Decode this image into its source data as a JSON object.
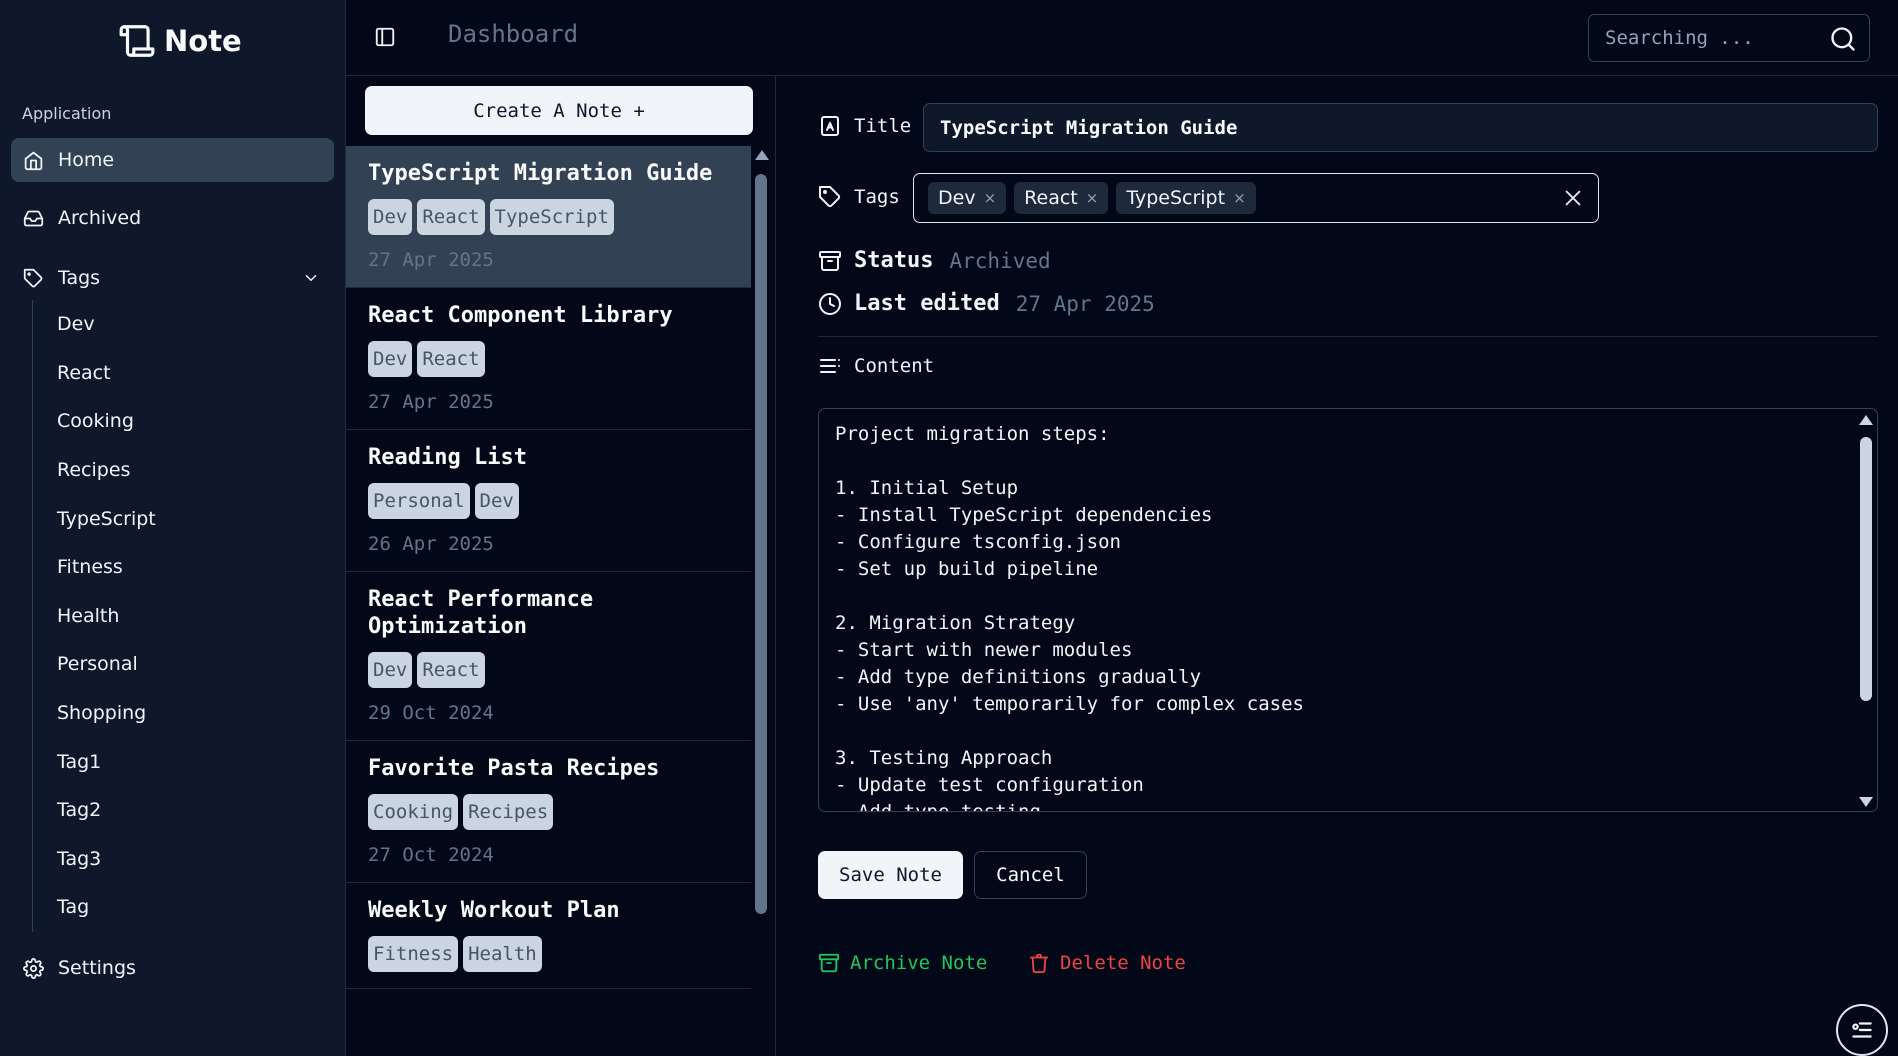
{
  "app": {
    "name": "Note"
  },
  "sidebar": {
    "group_label": "Application",
    "items": [
      {
        "label": "Home",
        "icon": "home-icon",
        "active": true
      },
      {
        "label": "Archived",
        "icon": "inbox-icon"
      },
      {
        "label": "Tags",
        "icon": "tag-icon"
      }
    ],
    "tags": [
      "Dev",
      "React",
      "Cooking",
      "Recipes",
      "TypeScript",
      "Fitness",
      "Health",
      "Personal",
      "Shopping",
      "Tag1",
      "Tag2",
      "Tag3",
      "Tag"
    ],
    "settings_label": "Settings"
  },
  "header": {
    "title": "Dashboard",
    "search_placeholder": "Searching ..."
  },
  "list": {
    "create_label": "Create A Note +",
    "notes": [
      {
        "title": "TypeScript Migration Guide",
        "tags": [
          "Dev",
          "React",
          "TypeScript"
        ],
        "date": "27 Apr 2025",
        "selected": true
      },
      {
        "title": "React Component Library",
        "tags": [
          "Dev",
          "React"
        ],
        "date": "27 Apr 2025"
      },
      {
        "title": "Reading List",
        "tags": [
          "Personal",
          "Dev"
        ],
        "date": "26 Apr 2025"
      },
      {
        "title": "React Performance Optimization",
        "tags": [
          "Dev",
          "React"
        ],
        "date": "29 Oct 2024"
      },
      {
        "title": "Favorite Pasta Recipes",
        "tags": [
          "Cooking",
          "Recipes"
        ],
        "date": "27 Oct 2024"
      },
      {
        "title": "Weekly Workout Plan",
        "tags": [
          "Fitness",
          "Health"
        ],
        "date": ""
      }
    ]
  },
  "detail": {
    "title_label": "Title",
    "title_value": "TypeScript Migration Guide",
    "tags_label": "Tags",
    "tags": [
      "Dev",
      "React",
      "TypeScript"
    ],
    "tag_remove": "×",
    "status_label": "Status",
    "status_value": "Archived",
    "edited_label": "Last edited",
    "edited_value": "27 Apr 2025",
    "content_label": "Content",
    "content": "Project migration steps:\n\n1. Initial Setup\n- Install TypeScript dependencies\n- Configure tsconfig.json\n- Set up build pipeline\n\n2. Migration Strategy\n- Start with newer modules\n- Add type definitions gradually\n- Use 'any' temporarily for complex cases\n\n3. Testing Approach\n- Update test configuration\n- Add type testing",
    "save_label": "Save Note",
    "cancel_label": "Cancel",
    "archive_label": "Archive Note",
    "delete_label": "Delete Note"
  },
  "colors": {
    "archive": "#22c55e",
    "delete": "#ef4444",
    "background": "#020817",
    "sidebar": "#0f172a"
  }
}
